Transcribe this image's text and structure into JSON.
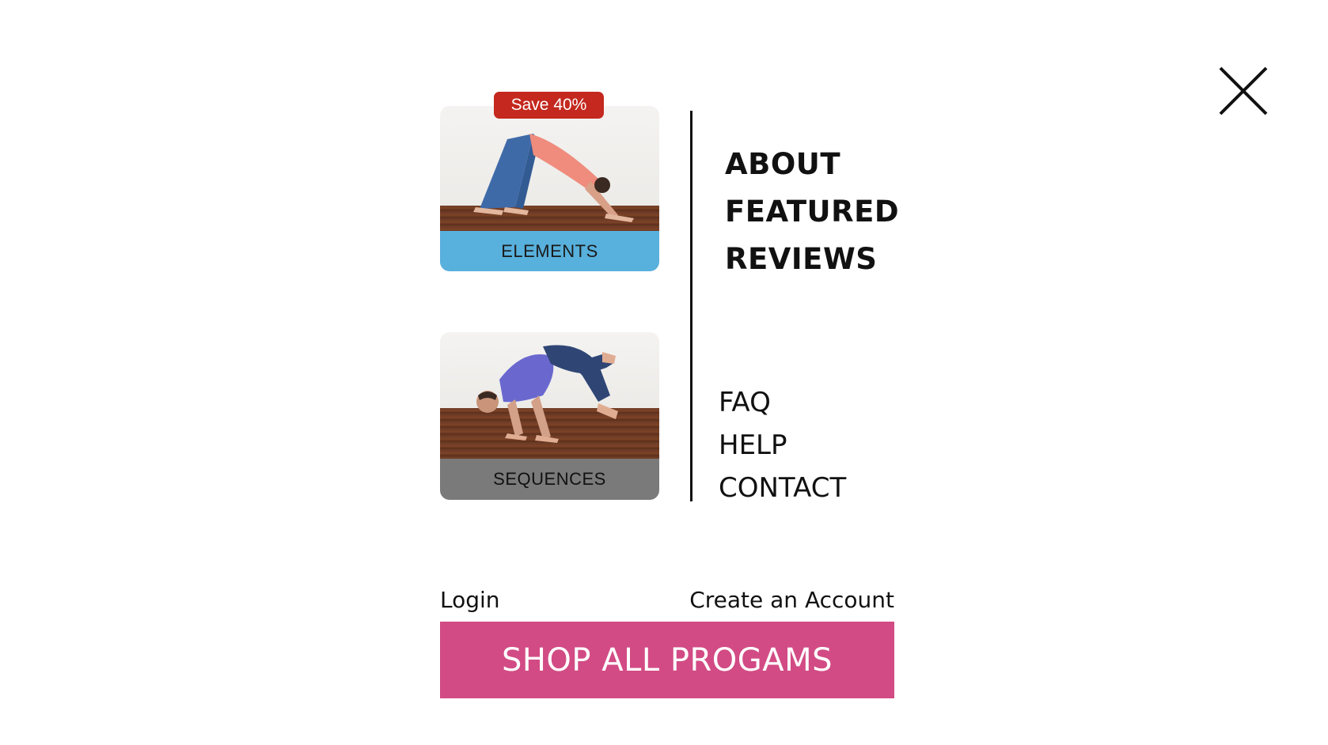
{
  "menu": {
    "close_icon": "close-icon"
  },
  "programs": [
    {
      "label": "ELEMENTS",
      "badge": "Save 40%",
      "label_color": "#58b0dc"
    },
    {
      "label": "SEQUENCES",
      "label_color": "#7a7a7a"
    }
  ],
  "primary_nav": [
    "ABOUT",
    "FEATURED",
    "REVIEWS"
  ],
  "secondary_nav": [
    "FAQ",
    "HELP",
    "CONTACT"
  ],
  "account": {
    "login": "Login",
    "create": "Create an Account"
  },
  "cta": {
    "label": "SHOP ALL PROGAMS",
    "color": "#d24b84"
  },
  "badge_color": "#c4281e"
}
